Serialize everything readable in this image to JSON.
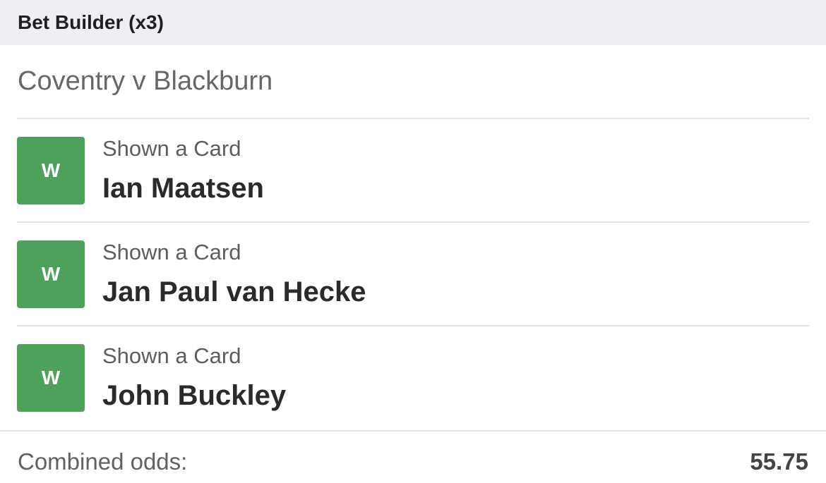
{
  "header": {
    "title": "Bet Builder (x3)"
  },
  "event": {
    "name": "Coventry v Blackburn"
  },
  "selections": [
    {
      "status": "W",
      "market": "Shown a Card",
      "player": "Ian Maatsen"
    },
    {
      "status": "W",
      "market": "Shown a Card",
      "player": "Jan Paul van Hecke"
    },
    {
      "status": "W",
      "market": "Shown a Card",
      "player": "John Buckley"
    }
  ],
  "footer": {
    "label": "Combined odds:",
    "value": "55.75"
  },
  "colors": {
    "win_badge": "#4da15a",
    "header_bg": "#eeeff3"
  }
}
